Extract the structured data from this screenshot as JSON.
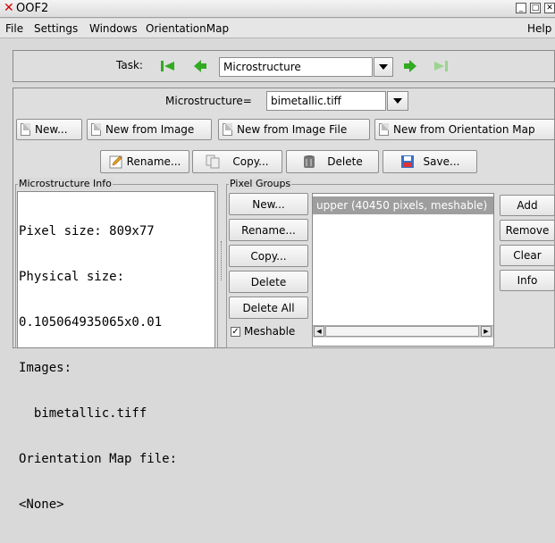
{
  "window": {
    "title": "OOF2",
    "close_glyph": "✕",
    "min_glyph": "_",
    "max_glyph": "□"
  },
  "menu": {
    "items": [
      "File",
      "Settings",
      "Windows",
      "OrientationMap"
    ],
    "help": "Help"
  },
  "task": {
    "label": "Task:",
    "value": "Microstructure"
  },
  "microstructure": {
    "label": "Microstructure=",
    "value": "bimetallic.tiff"
  },
  "buttons_row1": [
    "New...",
    "New from Image",
    "New from Image File",
    "New from Orientation Map"
  ],
  "buttons_row2": {
    "rename": "Rename...",
    "copy": "Copy...",
    "delete": "Delete",
    "save": "Save..."
  },
  "info": {
    "frame_label": "Microstructure Info",
    "lines": [
      "Pixel size: 809x77",
      "Physical size:",
      "0.105064935065x0.01",
      "Images:",
      "  bimetallic.tiff",
      "Orientation Map file:",
      "<None>"
    ]
  },
  "pixel_groups": {
    "frame_label": "Pixel Groups",
    "buttons": [
      "New...",
      "Rename...",
      "Copy...",
      "Delete",
      "Delete All"
    ],
    "meshable_label": "Meshable",
    "meshable_checked": true,
    "list_items": [
      "upper (40450 pixels, meshable)"
    ],
    "side_buttons": [
      "Add",
      "Remove",
      "Clear",
      "Info"
    ]
  },
  "colors": {
    "accent_green": "#33aa22",
    "selection": "#9e9e9e",
    "close_red": "#d40000"
  },
  "icons": [
    "prev-first-icon",
    "prev-icon",
    "next-icon",
    "next-last-icon",
    "document-icon",
    "pencil-icon",
    "copy-icon",
    "trash-icon",
    "floppy-icon",
    "checkbox-icon"
  ]
}
